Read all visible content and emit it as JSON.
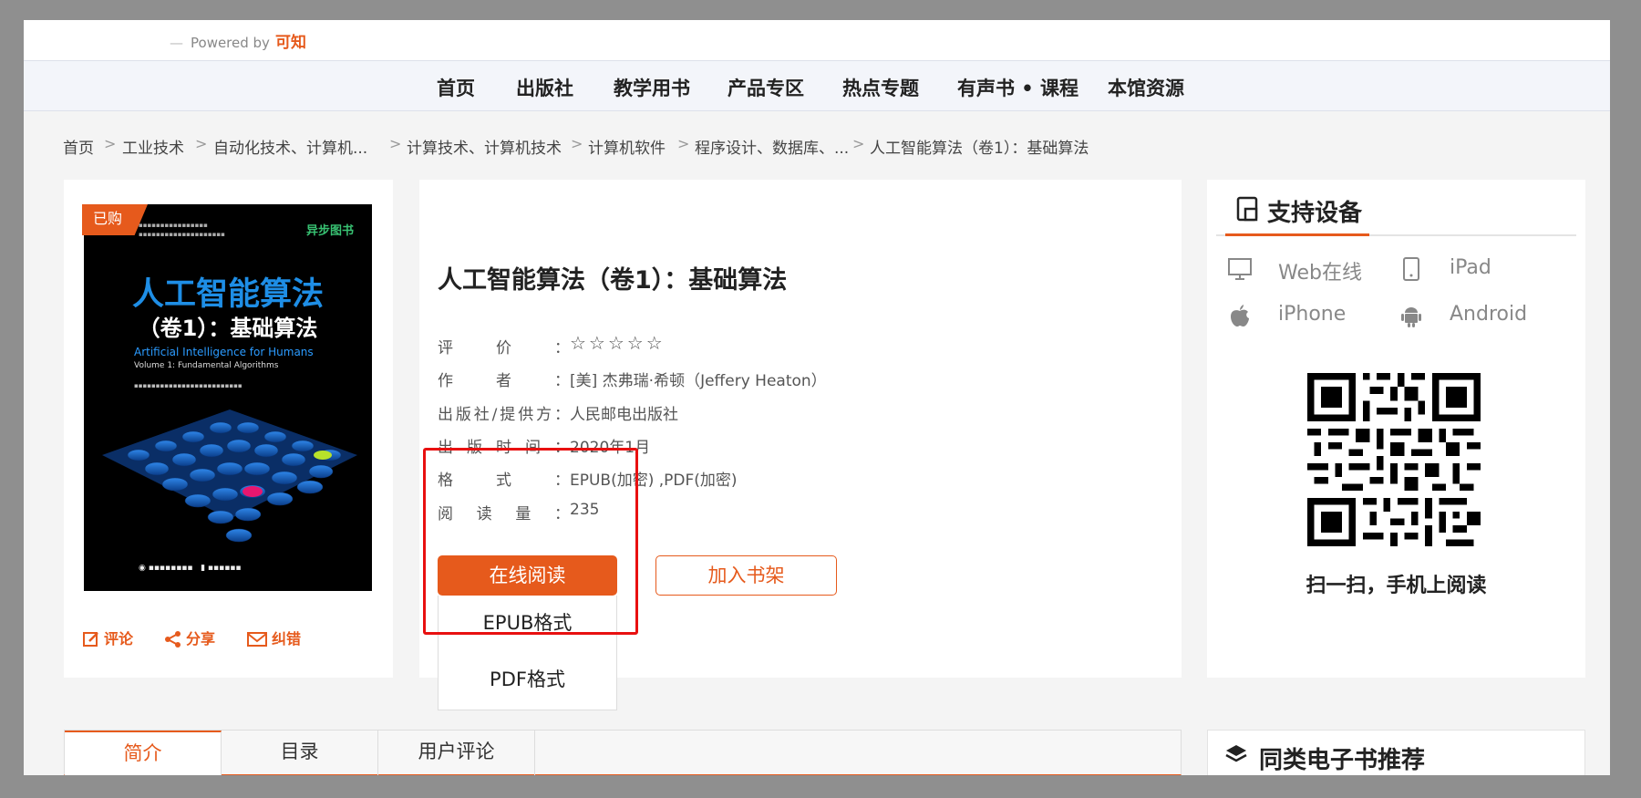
{
  "header": {
    "powered_by": "Powered by",
    "brand": "可知"
  },
  "nav": {
    "items": [
      "首页",
      "出版社",
      "教学用书",
      "产品专区",
      "热点专题",
      "有声书 • 课程",
      "本馆资源"
    ]
  },
  "breadcrumb": {
    "items": [
      "首页",
      "工业技术",
      "自动化技术、计算机...",
      "计算技术、计算机技术",
      "计算机软件",
      "程序设计、数据库、...",
      "人工智能算法（卷1）：基础算法"
    ],
    "separator": ">"
  },
  "cover": {
    "badge": "已购",
    "title_line1": "人工智能算法",
    "title_line2": "（卷1）：基础算法",
    "en_title": "Artificial Intelligence for Humans",
    "en_volume": "Volume 1: Fundamental Algorithms",
    "publisher_logo": "异步图书"
  },
  "actions": {
    "comment": "评论",
    "share": "分享",
    "report": "纠错"
  },
  "book": {
    "title": "人工智能算法（卷1）：基础算法",
    "rating": {
      "label": "评价：",
      "stars": "☆☆☆☆☆"
    },
    "author": {
      "label": "作者：",
      "value": "[美] 杰弗瑞·希顿（Jeffery Heaton）"
    },
    "publisher": {
      "label": "出版社/提供方：",
      "value": "人民邮电出版社"
    },
    "pub_date": {
      "label": "出版时间：",
      "value": "2020年1月"
    },
    "format": {
      "label": "格式：",
      "value": "EPUB(加密) ,PDF(加密)"
    },
    "reads": {
      "label": "阅读量：",
      "value": "235"
    }
  },
  "buttons": {
    "read_online": "在线阅读",
    "add_shelf": "加入书架"
  },
  "read_dropdown": {
    "options": [
      "EPUB格式",
      "PDF格式"
    ]
  },
  "devices": {
    "title": "支持设备",
    "items": [
      "Web在线",
      "iPad",
      "iPhone",
      "Android"
    ],
    "scan_text": "扫一扫，手机上阅读"
  },
  "tabs": {
    "items": [
      "简介",
      "目录",
      "用户评论"
    ],
    "active": "简介"
  },
  "recommend": {
    "title": "同类电子书推荐"
  },
  "colors": {
    "accent": "#e65a1c",
    "highlight": "#e81010"
  }
}
